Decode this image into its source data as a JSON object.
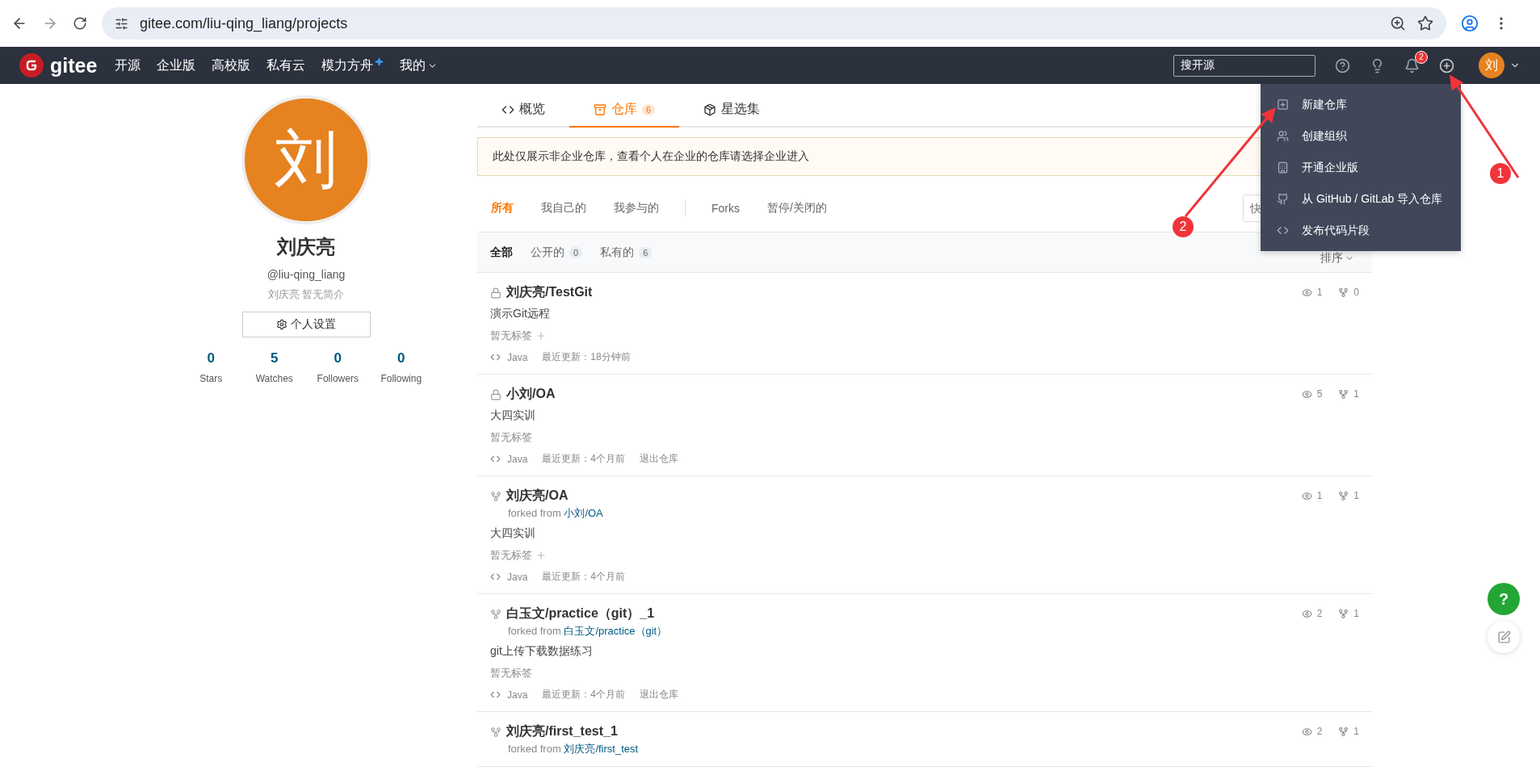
{
  "browser": {
    "url": "gitee.com/liu-qing_liang/projects"
  },
  "navbar": {
    "logo": "gitee",
    "items": [
      {
        "label": "开源",
        "kind": "plain"
      },
      {
        "label": "企业版",
        "kind": "plain"
      },
      {
        "label": "高校版",
        "kind": "plain"
      },
      {
        "label": "私有云",
        "kind": "plain"
      },
      {
        "label": "模力方舟",
        "kind": "sparkle"
      },
      {
        "label": "我的",
        "kind": "dropdown"
      }
    ],
    "search": {
      "placeholder": "搜开源"
    },
    "notification_count": "2",
    "avatar": "刘"
  },
  "dropdown": {
    "items": [
      {
        "label": "新建仓库"
      },
      {
        "label": "创建组织"
      },
      {
        "label": "开通企业版"
      },
      {
        "label": "从 GitHub / GitLab 导入仓库"
      },
      {
        "label": "发布代码片段"
      }
    ]
  },
  "profile": {
    "avatar": "刘",
    "name": "刘庆亮",
    "handle": "@liu-qing_liang",
    "bio": "刘庆亮 暂无简介",
    "settings_button": "个人设置",
    "stats": [
      {
        "value": "0",
        "label": "Stars"
      },
      {
        "value": "5",
        "label": "Watches"
      },
      {
        "value": "0",
        "label": "Followers"
      },
      {
        "value": "0",
        "label": "Following"
      }
    ]
  },
  "tabs": [
    {
      "label": "概览",
      "selected": false
    },
    {
      "label": "仓库",
      "count": "6",
      "selected": true
    },
    {
      "label": "星选集",
      "selected": false
    }
  ],
  "notice": "此处仅展示非企业仓库，查看个人在企业的仓库请选择企业进入",
  "filter_groups": [
    [
      {
        "label": "所有",
        "selected": true
      },
      {
        "label": "我自己的",
        "selected": false
      },
      {
        "label": "我参与的",
        "selected": false
      }
    ],
    [
      {
        "label": "Forks",
        "selected": false
      },
      {
        "label": "暂停/关闭的",
        "selected": false
      }
    ]
  ],
  "quick_search": {
    "placeholder": "快"
  },
  "visibility": [
    {
      "label": "全部",
      "selected": true
    },
    {
      "label": "公开的",
      "count": "0",
      "selected": false
    },
    {
      "label": "私有的",
      "count": "6",
      "selected": false
    }
  ],
  "sort": "排序",
  "repos": [
    {
      "kind": "private",
      "name": "刘庆亮/TestGit",
      "description": "演示Git远程",
      "tags": "暂无标签",
      "add_tag": true,
      "language": "Java",
      "updated": "最近更新：18分钟前",
      "watches": "1",
      "forks": "0"
    },
    {
      "kind": "private",
      "name": "小刘/OA",
      "description": "大四实训",
      "tags": "暂无标签",
      "add_tag": false,
      "language": "Java",
      "updated": "最近更新：4个月前",
      "leave": "退出仓库",
      "watches": "5",
      "forks": "1"
    },
    {
      "kind": "fork",
      "name": "刘庆亮/OA",
      "forked_prefix": "forked from",
      "forked_from": "小刘/OA",
      "description": "大四实训",
      "tags": "暂无标签",
      "add_tag": true,
      "language": "Java",
      "updated": "最近更新：4个月前",
      "watches": "1",
      "forks": "1"
    },
    {
      "kind": "fork",
      "name": "白玉文/practice（git）_1",
      "forked_prefix": "forked from",
      "forked_from": "白玉文/practice（git）",
      "description": "git上传下载数据练习",
      "tags": "暂无标签",
      "add_tag": false,
      "language": "Java",
      "updated": "最近更新：4个月前",
      "leave": "退出仓库",
      "watches": "2",
      "forks": "1"
    },
    {
      "kind": "fork",
      "name": "刘庆亮/first_test_1",
      "forked_prefix": "forked from",
      "forked_from": "刘庆亮/first_test",
      "watches": "2",
      "forks": "1"
    }
  ],
  "floating": {
    "help": "?"
  },
  "annotations": [
    {
      "number": "1"
    },
    {
      "number": "2"
    }
  ]
}
